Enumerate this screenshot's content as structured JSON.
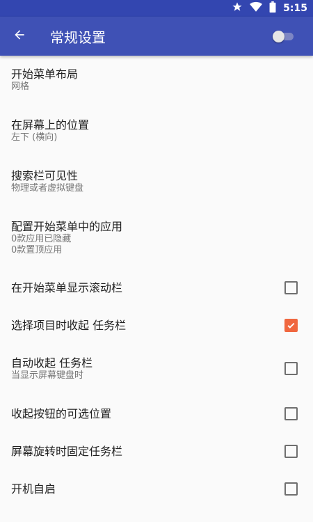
{
  "status": {
    "time": "5:15",
    "icons": [
      "star-icon",
      "wifi-icon",
      "battery-icon"
    ]
  },
  "toolbar": {
    "title": "常规设置",
    "toggle_on": false
  },
  "items": [
    {
      "label": "开始菜单布局",
      "sub": "网格"
    },
    {
      "label": "在屏幕上的位置",
      "sub": "左下 (横向)"
    },
    {
      "label": "搜索栏可见性",
      "sub": "物理或者虚拟键盘"
    },
    {
      "label": "配置开始菜单中的应用",
      "sub": "0款应用已隐藏",
      "sub2": "0款置顶应用"
    },
    {
      "label": "在开始菜单显示滚动栏",
      "checked": false
    },
    {
      "label": "选择项目时收起 任务栏",
      "checked": true
    },
    {
      "label": "自动收起 任务栏",
      "sub": "当显示屏幕键盘时",
      "checked": false
    },
    {
      "label": "收起按钮的可选位置",
      "checked": false
    },
    {
      "label": "屏幕旋转时固定任务栏",
      "checked": false
    },
    {
      "label": "开机自启",
      "checked": false
    }
  ],
  "colors": {
    "appbar": "#3f51b5",
    "statusbar": "#3346b0",
    "accent": "#f0673f"
  }
}
